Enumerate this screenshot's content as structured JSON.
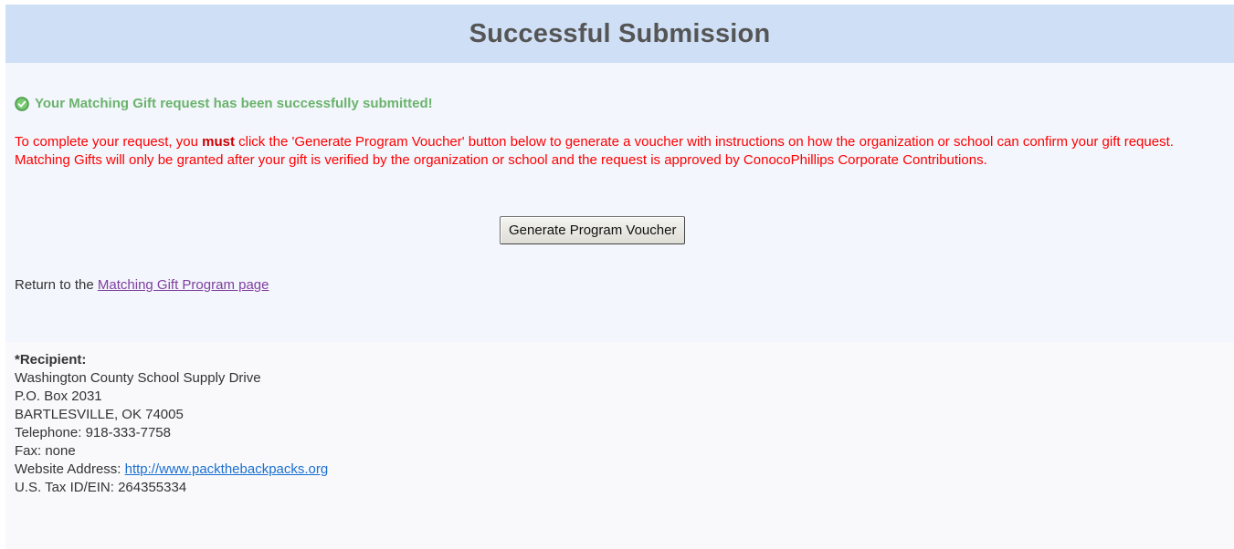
{
  "header": {
    "title": "Successful Submission"
  },
  "main": {
    "success_message": "Your Matching Gift request has been successfully submitted!",
    "notice": {
      "before_must": "To complete your request, you ",
      "must": "must",
      "after_must": " click the 'Generate Program Voucher' button below to generate a voucher with instructions on how the organization or school can confirm your gift request. Matching Gifts will only be granted after your gift is verified by the organization or school and the request is approved by ConocoPhillips Corporate Contributions."
    },
    "voucher_button_label": "Generate Program Voucher",
    "return_prefix": "Return to the ",
    "return_link_label": "Matching Gift Program page"
  },
  "recipient": {
    "label": "*Recipient:",
    "name": "Washington County School Supply Drive",
    "address_line": "P.O. Box 2031",
    "city_line": "BARTLESVILLE, OK 74005",
    "telephone": "Telephone: 918-333-7758",
    "fax": "Fax: none",
    "website_prefix": "Website Address: ",
    "website_url": "http://www.packthebackpacks.org",
    "tax_id": "U.S. Tax ID/EIN: 264355334"
  },
  "colors": {
    "header_bg": "#cfdff5",
    "success_green": "#6bb36d",
    "notice_red": "#ff0000",
    "link_visited": "#8040a0",
    "link_blue": "#1a6fd0"
  },
  "icons": {
    "success": "check-circle-icon"
  }
}
